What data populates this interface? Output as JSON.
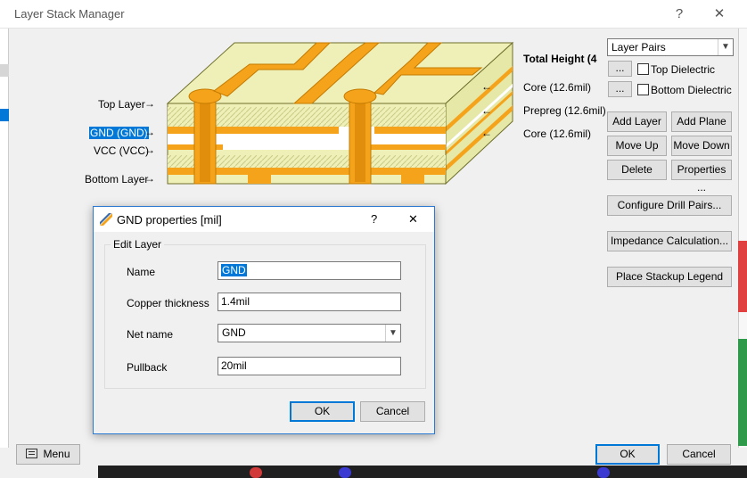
{
  "window": {
    "title": "Layer Stack Manager",
    "help_label": "?",
    "close_label": "✕"
  },
  "diagram": {
    "labels": {
      "top_layer": "Top Layer",
      "gnd": "GND (GND)",
      "vcc": "VCC (VCC)",
      "bottom_layer": "Bottom Layer",
      "total_height": "Total Height (4",
      "core1": "Core (12.6mil)",
      "prepreg": "Prepreg (12.6mil)",
      "core2": "Core (12.6mil)"
    },
    "colors": {
      "copper": "#f5a31a",
      "dielectric": "#eef0b8",
      "edge": "#6e6e2a"
    }
  },
  "side_panel": {
    "layer_pairs": "Layer Pairs",
    "dots": "...",
    "top_dielectric": "Top Dielectric",
    "bottom_dielectric": "Bottom Dielectric",
    "add_layer": "Add Layer",
    "add_plane": "Add Plane",
    "move_up": "Move Up",
    "move_down": "Move Down",
    "delete": "Delete",
    "properties": "Properties ...",
    "configure_drill": "Configure Drill Pairs...",
    "impedance": "Impedance Calculation...",
    "place_legend": "Place Stackup Legend"
  },
  "footer": {
    "menu": "Menu",
    "ok": "OK",
    "cancel": "Cancel"
  },
  "dialog": {
    "title": "GND properties [mil]",
    "help": "?",
    "close": "✕",
    "group": "Edit Layer",
    "name_label": "Name",
    "name_value": "GND",
    "copper_label": "Copper thickness",
    "copper_value": "1.4mil",
    "net_label": "Net name",
    "net_value": "GND",
    "pullback_label": "Pullback",
    "pullback_value": "20mil",
    "ok": "OK",
    "cancel": "Cancel"
  }
}
